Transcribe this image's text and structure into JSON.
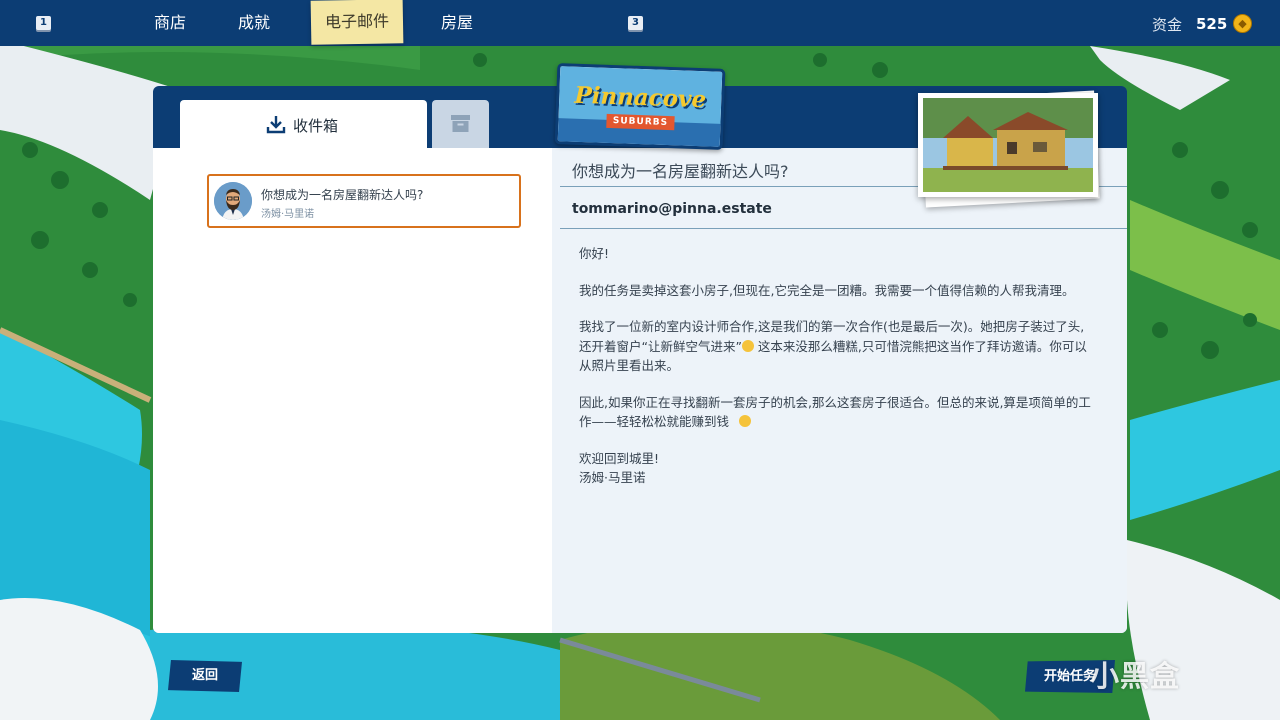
{
  "nav": {
    "key_left": "1",
    "key_right": "3",
    "tabs": [
      {
        "label": "商店"
      },
      {
        "label": "成就"
      },
      {
        "label": "电子邮件"
      },
      {
        "label": "房屋"
      }
    ],
    "active_tab": "电子邮件",
    "funds_label": "资金",
    "funds_value": "525"
  },
  "logo": {
    "name": "Pinnacove",
    "subtitle": "SUBURBS"
  },
  "mailbox": {
    "inbox_label": "收件箱",
    "items": [
      {
        "subject": "你想成为一名房屋翻新达人吗?",
        "sender": "汤姆·马里诺"
      }
    ]
  },
  "email": {
    "subject": "你想成为一名房屋翻新达人吗?",
    "from": "tommarino@pinna.estate",
    "greeting": "你好!",
    "p1": "我的任务是卖掉这套小房子,但现在,它完全是一团糟。我需要一个值得信赖的人帮我清理。",
    "p2a": "我找了一位新的室内设计师合作,这是我们的第一次合作(也是最后一次)。她把房子装过了头,还开着窗户“让新鲜空气进来”",
    "p2b": " 这本来没那么糟糕,只可惜浣熊把这当作了拜访邀请。你可以从照片里看出来。",
    "p3": "因此,如果你正在寻找翻新一套房子的机会,那么这套房子很适合。但总的来说,算是项简单的工作——轻轻松松就能赚到钱 ",
    "closing": "欢迎回到城里!",
    "signature": "汤姆·马里诺"
  },
  "buttons": {
    "back": "返回",
    "start": "开始任务"
  },
  "watermark": "小黑盒",
  "colors": {
    "navy": "#0c3d74",
    "highlight_border": "#d8721c",
    "active_tab": "#f4e7a4",
    "coin": "#f2b418"
  }
}
